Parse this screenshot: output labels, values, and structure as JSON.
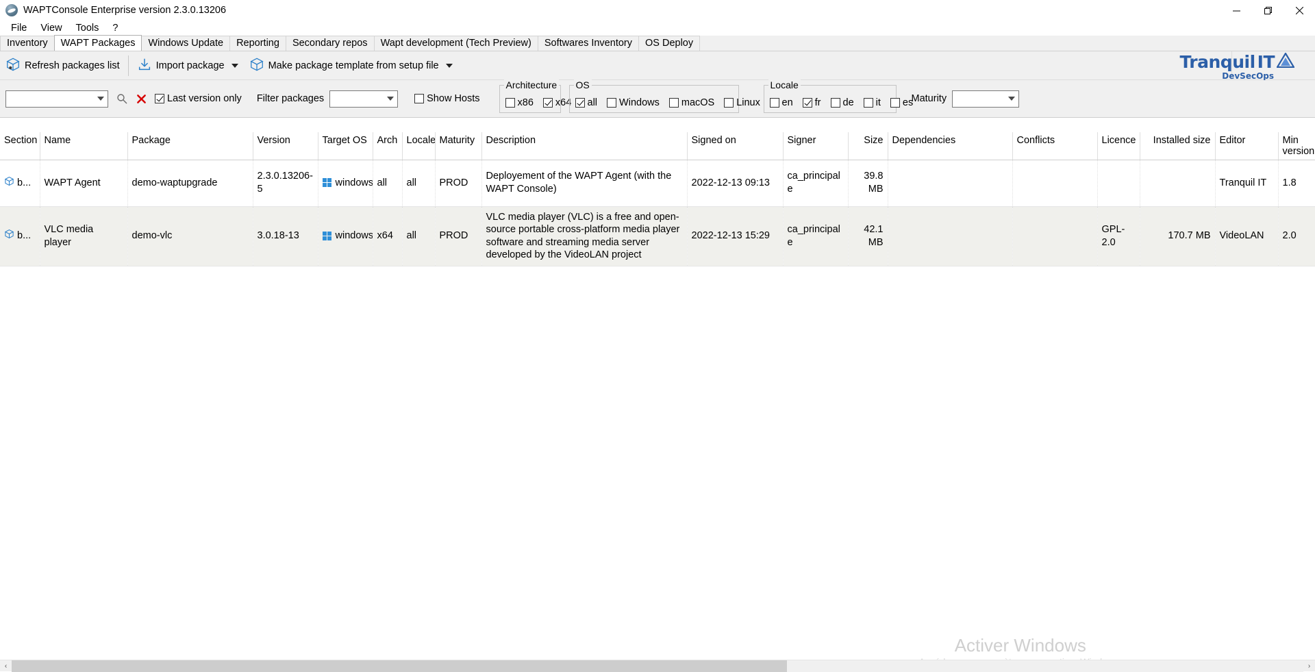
{
  "window": {
    "title": "WAPTConsole Enterprise version 2.3.0.13206",
    "icon": "wapt-app-icon",
    "minimize_label": "Minimize",
    "maximize_label": "Restore",
    "close_label": "Close"
  },
  "menubar": {
    "items": [
      {
        "label": "File",
        "name": "menu-file"
      },
      {
        "label": "View",
        "name": "menu-view"
      },
      {
        "label": "Tools",
        "name": "menu-tools"
      },
      {
        "label": "?",
        "name": "menu-help"
      }
    ]
  },
  "tabs": [
    {
      "label": "Inventory",
      "active": false
    },
    {
      "label": "WAPT Packages",
      "active": true
    },
    {
      "label": "Windows Update",
      "active": false
    },
    {
      "label": "Reporting",
      "active": false
    },
    {
      "label": "Secondary repos",
      "active": false
    },
    {
      "label": "Wapt development (Tech Preview)",
      "active": false
    },
    {
      "label": "Softwares Inventory",
      "active": false
    },
    {
      "label": "OS Deploy",
      "active": false
    }
  ],
  "toolbar": {
    "refresh_label": "Refresh packages list",
    "import_label": "Import package",
    "template_label": "Make package template from setup file"
  },
  "brand": {
    "name_part1": "Tranquil",
    "name_part2": "IT",
    "tagline": "DevSecOps",
    "color": "#2c5fa8"
  },
  "filters": {
    "search_combo_value": "",
    "search_combo_placeholder": "",
    "search_icon": "magnifier-icon",
    "clear_icon": "red-x-icon",
    "clear_color": "#d60000",
    "last_version_only": {
      "label": "Last version only",
      "checked": true
    },
    "filter_packages_label": "Filter packages",
    "filter_packages_value": "",
    "show_hosts": {
      "label": "Show Hosts",
      "checked": false
    },
    "architecture": {
      "title": "Architecture",
      "options": [
        {
          "label": "x86",
          "checked": false
        },
        {
          "label": "x64",
          "checked": true
        }
      ]
    },
    "os": {
      "title": "OS",
      "options": [
        {
          "label": "all",
          "checked": true
        },
        {
          "label": "Windows",
          "checked": false
        },
        {
          "label": "macOS",
          "checked": false
        },
        {
          "label": "Linux",
          "checked": false
        }
      ]
    },
    "locale": {
      "title": "Locale",
      "options": [
        {
          "label": "en",
          "checked": false
        },
        {
          "label": "fr",
          "checked": true
        },
        {
          "label": "de",
          "checked": false
        },
        {
          "label": "it",
          "checked": false
        },
        {
          "label": "es",
          "checked": false
        }
      ]
    },
    "maturity_label": "Maturity",
    "maturity_value": ""
  },
  "table": {
    "columns": [
      "Section",
      "Name",
      "Package",
      "Version",
      "Target OS",
      "Arch",
      "Locale",
      "Maturity",
      "Description",
      "Signed on",
      "Signer",
      "Size",
      "Dependencies",
      "Conflicts",
      "Licence",
      "Installed size",
      "Editor",
      "Min version"
    ],
    "rows": [
      {
        "section": "b...",
        "section_icon": "package-box-icon",
        "name": "WAPT Agent",
        "package": "demo-waptupgrade",
        "version": "2.3.0.13206-5",
        "target_os": "windows",
        "target_os_icon": "windows-logo-icon",
        "arch": "all",
        "locale": "all",
        "maturity": "PROD",
        "description": "Deployement of the WAPT Agent (with the WAPT Console)",
        "signed_on": "2022-12-13 09:13",
        "signer": "ca_principale",
        "size": "39.8 MB",
        "dependencies": "",
        "conflicts": "",
        "licence": "",
        "installed_size": "",
        "editor": "Tranquil IT",
        "min_version": "1.8"
      },
      {
        "section": "b...",
        "section_icon": "package-box-icon",
        "name": "VLC media player",
        "package": "demo-vlc",
        "version": "3.0.18-13",
        "target_os": "windows",
        "target_os_icon": "windows-logo-icon",
        "arch": "x64",
        "locale": "all",
        "maturity": "PROD",
        "description": "VLC media player (VLC) is a free and open-source portable cross-platform media player software and streaming media server developed by the VideoLAN project",
        "signed_on": "2022-12-13 15:29",
        "signer": "ca_principale",
        "size": "42.1 MB",
        "dependencies": "",
        "conflicts": "",
        "licence": "GPL-2.0",
        "installed_size": "170.7 MB",
        "editor": "VideoLAN",
        "min_version": "2.0"
      }
    ]
  },
  "watermark": {
    "line1": "Activer Windows",
    "line2": "Accédez aux paramètres pour activer Windows."
  },
  "scrollbar": {
    "left_arrow": "‹",
    "right_arrow": "›"
  }
}
